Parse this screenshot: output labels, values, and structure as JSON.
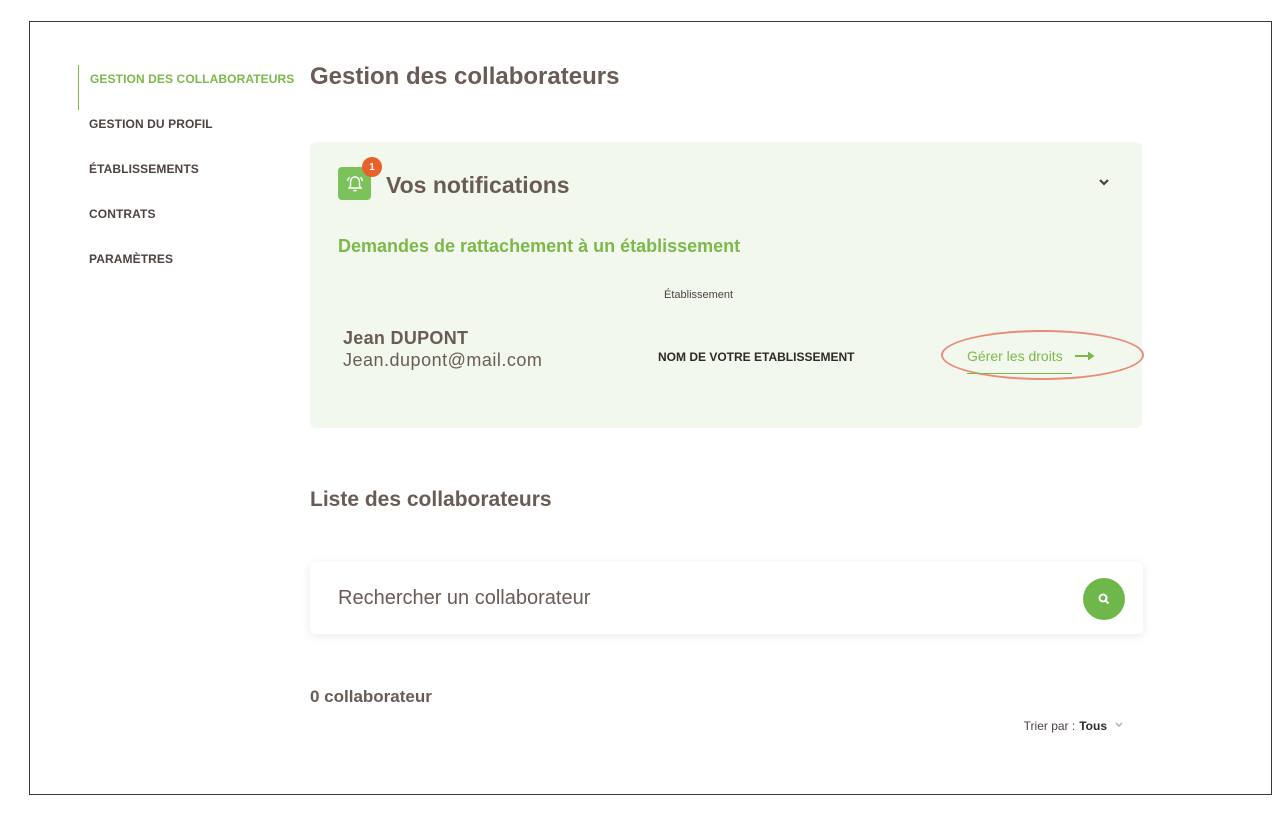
{
  "sidebar": {
    "items": [
      {
        "label": "GESTION DES COLLABORATEURS",
        "active": true
      },
      {
        "label": "GESTION DU PROFIL"
      },
      {
        "label": "ÉTABLISSEMENTS"
      },
      {
        "label": "CONTRATS"
      },
      {
        "label": "PARAMÈTRES"
      }
    ]
  },
  "page": {
    "title": "Gestion des collaborateurs"
  },
  "notifications": {
    "title": "Vos notifications",
    "badge_count": "1",
    "subtitle": "Demandes de rattachement à un établissement",
    "column_header": "Établissement",
    "request": {
      "name": "Jean DUPONT",
      "email": "Jean.dupont@mail.com",
      "establishment": "NOM DE VOTRE ETABLISSEMENT",
      "action_label": "Gérer les droits"
    }
  },
  "collaborators": {
    "title": "Liste des collaborateurs",
    "search_placeholder": "Rechercher un collaborateur",
    "count_label": "0 collaborateur",
    "sort_label": "Trier par :",
    "sort_value": "Tous"
  },
  "colors": {
    "accent": "#7cb84a",
    "badge": "#e8602c",
    "card_bg": "#f2f8ee",
    "highlight": "#e98c78"
  }
}
